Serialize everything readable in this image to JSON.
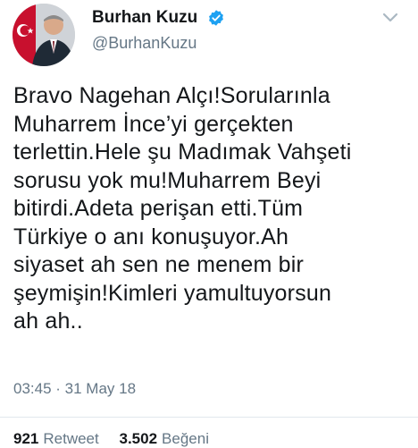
{
  "author": {
    "display_name": "Burhan Kuzu",
    "handle": "@BurhanKuzu",
    "avatar_icon": "profile-photo",
    "verified_icon": "verified-badge-icon"
  },
  "tweet": {
    "text": "Bravo Nagehan Alçı!Sorularınla\nMuharrem İnce’yi gerçekten\nterlettin.Hele şu Madımak Vahşeti\nsorusu yok mu!Muharrem Beyi\nbitirdi.Adeta perişan etti.Tüm\nTürkiye o anı konuşuyor.Ah\nsiyaset ah sen ne menem bir\nşeymişin!Kimleri yamultuyorsun\nah ah..",
    "timestamp": "03:45 · 31 May 18"
  },
  "stats": {
    "retweets_count": "921",
    "retweets_label": "Retweet",
    "likes_count": "3.502",
    "likes_label": "Beğeni"
  },
  "colors": {
    "verified": "#1da1f2",
    "secondary_text": "#657786",
    "primary_text": "#14171a"
  }
}
